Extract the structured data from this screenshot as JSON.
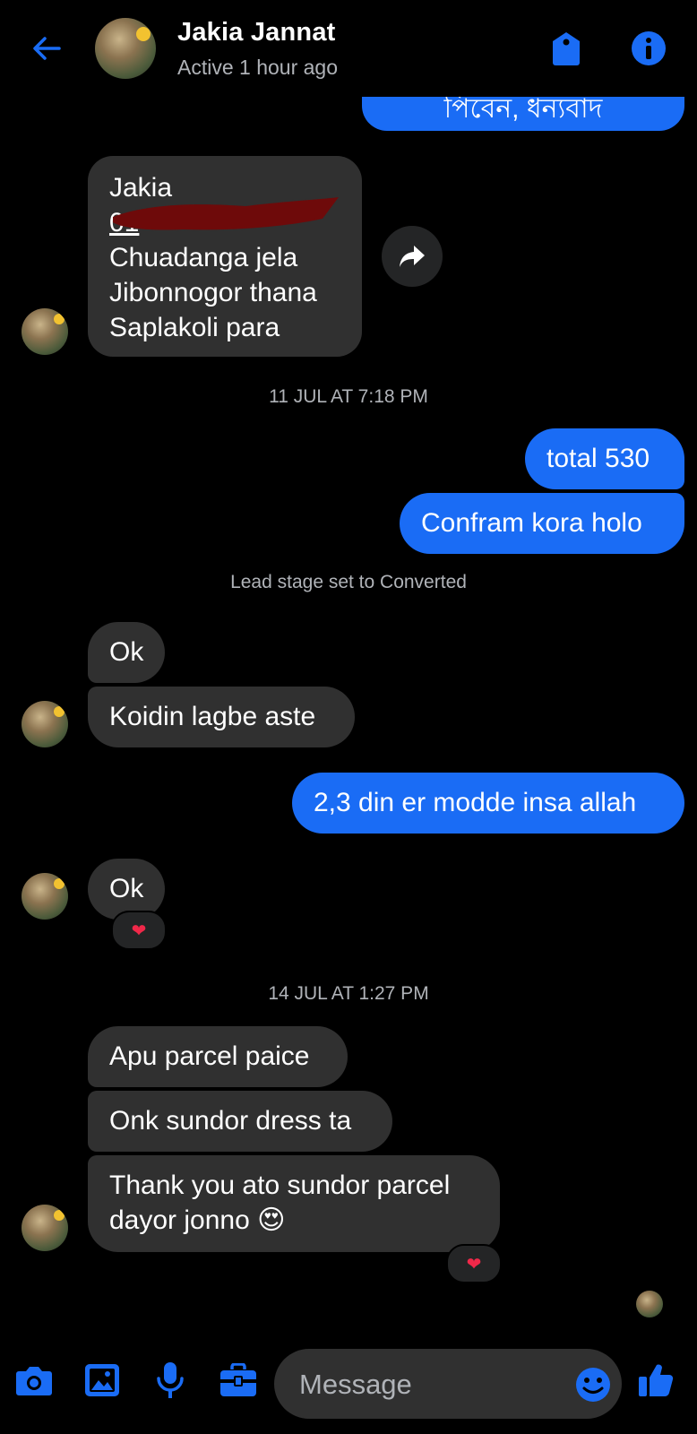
{
  "header": {
    "name": "Jakia Jannat",
    "status": "Active 1 hour ago"
  },
  "messages": {
    "partial_top": "পিবেন, ধন্যবাদ",
    "address": {
      "line1": "Jakia",
      "line2": "01",
      "line3": "Chuadanga jela",
      "line4": "Jibonnogor thana",
      "line5": "Saplakoli para"
    },
    "ts1": "11 JUL AT 7:18 PM",
    "out1": "total 530",
    "out2": "Confram kora holo",
    "system": "Lead stage set to Converted",
    "in1": "Ok",
    "in2": "Koidin lagbe aste",
    "out3": "2,3 din er modde insa allah",
    "in3": "Ok",
    "ts2": "14 JUL AT 1:27 PM",
    "in4": "Apu parcel paice",
    "in5": "Onk sundor dress ta",
    "in6a": "Thank you ato sundor parcel",
    "in6b": "dayor jonno 😍"
  },
  "reactions": {
    "heart": "❤"
  },
  "composer": {
    "placeholder": "Message"
  },
  "colors": {
    "accent": "#1a6cf5",
    "incoming": "#303030",
    "background": "#000000"
  },
  "icons": [
    "back-arrow-icon",
    "tag-icon",
    "info-icon",
    "share-icon",
    "camera-icon",
    "image-icon",
    "microphone-icon",
    "briefcase-icon",
    "emoji-icon",
    "thumbs-up-icon"
  ]
}
